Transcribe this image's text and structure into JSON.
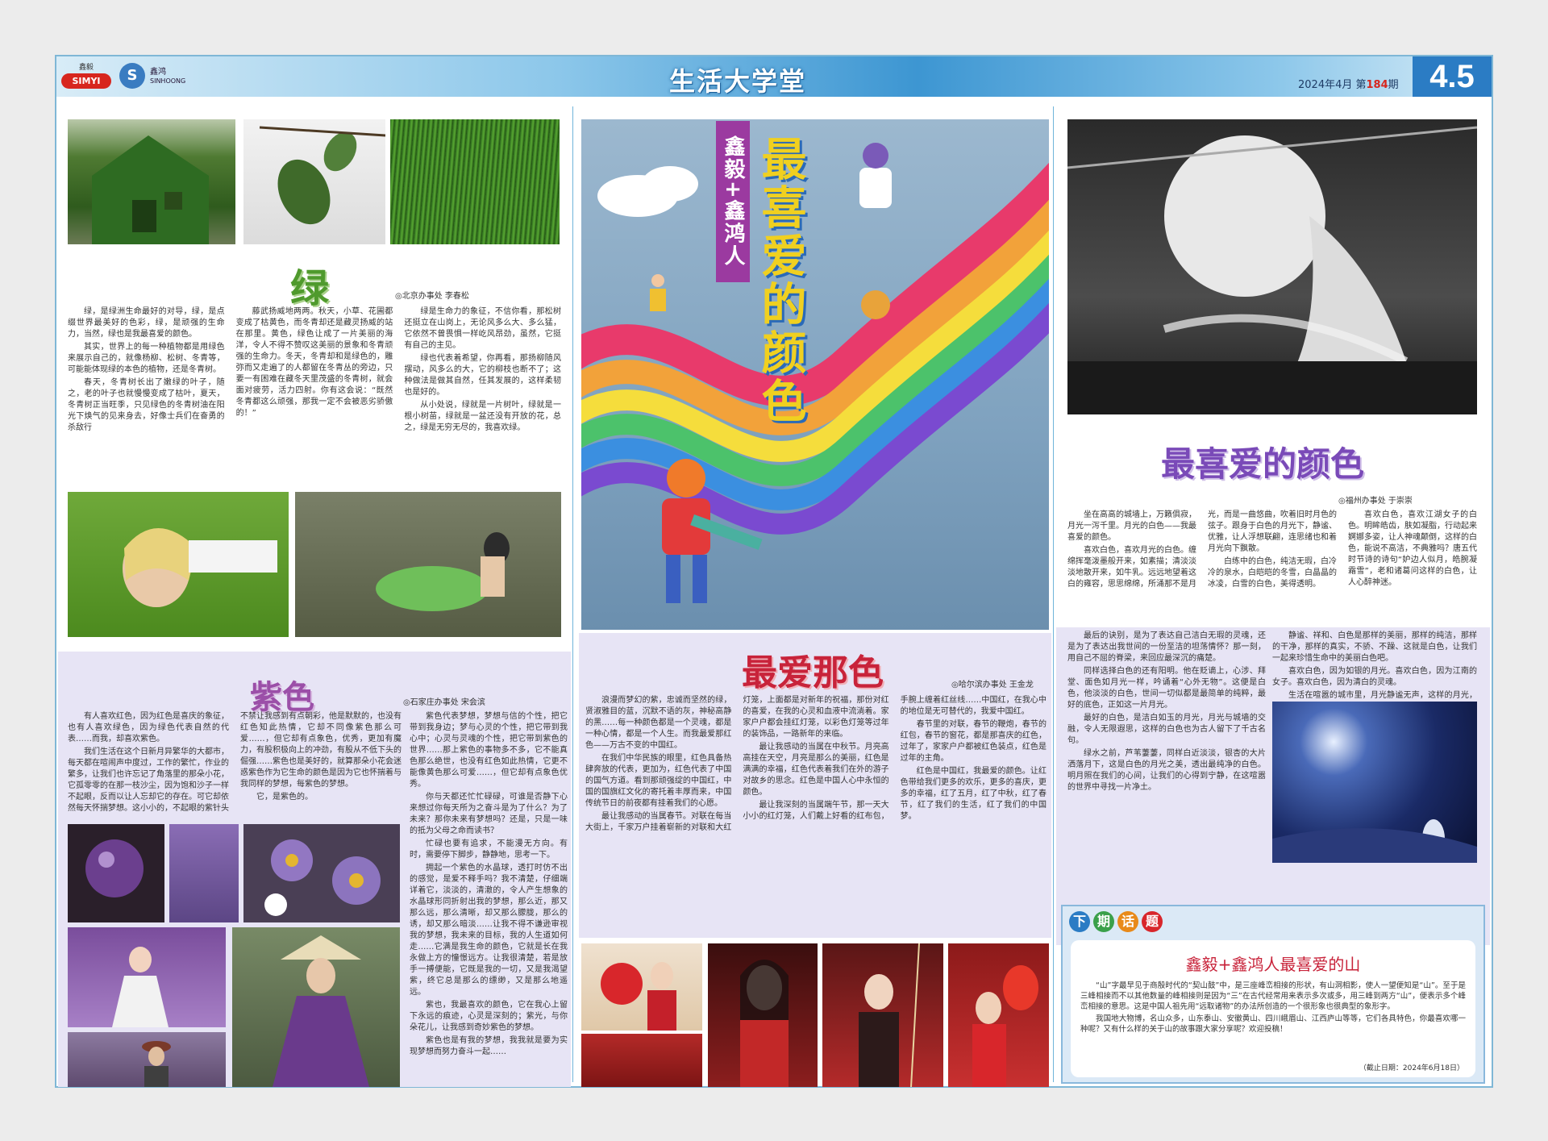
{
  "masthead": {
    "logo1_cn": "鑫毅",
    "logo1_en": "SIMYI",
    "logo2_mark": "S",
    "logo2_cn": "鑫鸿",
    "logo2_en": "SINHOONG",
    "title": "生活大学堂",
    "date": "2024年4月",
    "issue_prefix": "第",
    "issue_number": "184",
    "issue_suffix": "期",
    "page_numbers": "4.5",
    "color_bar": "#2b7cc4"
  },
  "article_green": {
    "title": "绿",
    "byline_office": "◎北京办事处",
    "byline_author": "李春松",
    "paragraphs": [
      "绿，是绿洲生命最好的对导，绿，是点缀世界最美好的色彩，绿，是顽强的生命力，当然，绿也是我最喜爱的颜色。",
      "其实，世界上的每一种植物都是用绿色来展示自己的，就像杨柳、松树、冬青等，可能能体现绿的本色的植物，还是冬青树。",
      "春天，冬青树长出了嫩绿的叶子，随之，老的叶子也就慢慢变成了枯叶，夏天，冬青树正当旺季，只见绿色的冬青树油在阳光下焕气的见来身去，好像士兵们在奋勇的杀敌行",
      "藤武扬威地两两。秋天，小草、花圃都变成了枯黄色，而冬青却还是藏灵扬威的站在那里。黄色，绿色让成了一片美丽的海洋，令人不得不赞叹这美丽的景象和冬青顽强的生命力。冬天，冬青却和是绿色的，雕弥而又走遍了的人都留在冬青丛的旁边，只要一有困难在藏冬天里茂盛的冬青树，就会面对疲劳，活力四射。你有这会说：“既然冬青都这么顽强，那我一定不会被恶劣骄傲的！”",
      "绿是生命力的象征，不信你看，那松树还挺立在山岗上，无论风多么大、多么猛，它依然不曾畏惧一样屹风昂劲，虽然，它挺有自己的主见。",
      "绿也代表着希望，你再看，那扬柳随风摆动，风多么的大，它的柳枝也断不了；这种做法是做其自然，任其发展的，这样柔韧也是好的。",
      "从小处说，绿就是一片树叶，绿就是一根小树苗，绿就是一盆还没有开放的花，总之，绿是无穷无尽的，我喜欢绿。"
    ]
  },
  "article_purple": {
    "title": "紫色",
    "byline_office": "◎石家庄办事处",
    "byline_author": "宋会滨",
    "paragraphs": [
      "有人喜欢红色，因为红色是喜庆的象征，也有人喜欢绿色，因为绿色代表自然的代表……而我，却喜欢紫色。",
      "我们生活在这个日新月异繁华的大都市，每天都在喧闹声中度过，工作的繁忙，作业的繁多，让我们也许忘记了角落里的那朵小花，它孤零零的在那一枝沙尘，因为饱和沙子一样不起眼，反而以让人忘却它的存在。可它却依然每天怀揣梦想。这小小的，不起眼的紫针头不禁让我感到有点朝彩，他是默默的，也没有红色知此热情，它却不同像紫色那么可爱……，但它却有点象色，优秀，更加有魔力，有股积极向上的冲劲，有股从不低下头的倔强……紫色也是美好的，就算那朵小花会迷惑紫色作为它生命的颜色是因为它也怀揣着与我同样的梦想，每紫色的梦想。",
      "它，是紫色的。",
      "紫色代表梦想，梦想与信的个性，把它带到我身边；梦与心灵的个性，把它带到我心中；心灵与灵魂的个性，把它带到紫色的世界……那上紫色的事物多不多，它不能真色那么绝世，也没有红色如此热情，它更不能像黄色那么可爱……，但它却有点象色优秀。",
      "你与天都还忙忙碌碌，可谁是否静下心来想过你每天所为之奋斗是为了什么？为了未来？那你未来有梦想吗？还是，只是一味的抵为父母之命而读书？",
      "忙碌也要有追求，不能漫无方向。有时，需要停下脚步，静静地，思考一下。",
      "拥起一个紫色的水晶球，透打时仿不出的感觉，是爱不释手吗？我不清楚，仔细端详着它，淡淡的，清澈的，令人产生想象的水晶球形同折射出我的梦想，那么近，那又那么远，那么清晰，却又那么朦胧，那么的诱，却又那么暗淡……让我不得不谦逊审视我的梦想，我未来的目标，我的人生道如何走……它满是我生命的颜色，它就是长在我永做上方的憧憬远方。让我很清楚，若是放手一搏便能，它既是我的一切，又是我渴望紫，终它总是那么的缥缈，又是那么地遥远。",
      "紫也，我最喜欢的颜色，它在我心上留下永远的痕迹，心灵是深刻的；紫光，与你朵花儿，让我感到奇妙紫色的梦想。",
      "紫色也是有我的梦想，我我就是要为实现梦想而努力奋斗一起……"
    ]
  },
  "feature_center": {
    "side_label": "鑫毅+鑫鸿人",
    "title": "最喜爱的颜色"
  },
  "article_red": {
    "title": "最爱那色",
    "byline_office": "◎哈尔滨办事处",
    "byline_author": "王金龙",
    "paragraphs": [
      "浪漫而梦幻的紫，忠诚而坚然的绿，贤淑雅目的蓝，沉默不语的灰，神秘高静的黑……每一种颜色都是一个灵魂，都是一种心情，都是一个人生。而我最爱那红色——万古不变的中国红。",
      "在我们中华民族的眼里，红色具备热肆奔放的代表，更加为，红色代表了中国的国气方道。看到那顽强绽的中国红，中国的国旗红文化的寄托着丰厚而来，中国传统节日的前夜都有挂着我们的心愿。",
      "最让我感动的当属春节。对联在每当大街上，千家万户挂着崭新的对联和大红灯笼，上面都是对新年的祝福，那份对红的喜爱，在我的心灵和血液中流淌着。家家户户都会挂红灯笼，以彩色灯笼等过年的装饰品，一路新年的来临。",
      "最让我感动的当属在中秋节。月亮高高挂在天空，月亮是那么的美丽，红色是满满的幸福，红色代表着我们在外的游子对故乡的思念。红色是中国人心中永恒的颜色。",
      "最让我深刻的当属端午节，那一天大小小的红灯笼，人们戴上好看的红布包，手腕上缠着红丝线……中国红，在我心中的地位是无可替代的，我爱中国红。",
      "春节里的对联，春节的鞭炮，春节的红包，春节的窗花，都是那喜庆的红色，过年了，家家户户都被红色装点，红色是过年的主角。",
      "红色是中国红，我最爱的颜色。让红色带给我们更多的欢乐，更多的喜庆，更多的幸福，红了五月，红了中秋，红了春节，红了我们的生活，红了我们的中国梦。"
    ]
  },
  "article_moon": {
    "title": "最喜爱的颜色",
    "byline_office": "◎福州办事处",
    "byline_author": "于崇崇",
    "paragraphs": [
      "坐在高高的城墙上，万籁俱寂，月光一泻千里。月光的白色——我最喜爱的颜色。",
      "喜欢白色，喜欢月光的白色。缠绵挥毫泼墨般开来，如素描；清淡淡淡地散开来，如牛乳。远远地望着这白的雍容，思思绵绵，所涌那不是月光，而是一曲悠曲，吹着旧时月色的弦子。跟身于白色的月光下，静谧、优雅，让人浮想联翩，连思绪也和着月光向下飘散。",
      "白练中的白色，纯洁无瑕，白冷冷的泉水，白皑皑的冬雪，白晶晶的冰凌，白雪的白色，美得透明。",
      "喜欢白色，喜欢江湖女子的白色。明眸皓齿，肤如凝脂，行动起来婀娜多姿，让人神魂颠倒，这样的白色，能说不高洁，不典雅吗？唐五代时节诗的诗句“妒边人似月，皓腕凝霜雪”，老和诸葛问这样的白色，让人心醉神迷。",
      "最后的诀别，是为了表达自己洁白无瑕的灵魂，还是为了表达出我世间的一份至洁的坦荡情怀？那一刻，用自己不屈的脊梁，来回应最深沉的痛楚。",
      "同样选择白色的还有阳明。他在贬谪上，心涉、拜堂、面色如月光一样，吟诵着“心外无物”。这便是白色，他淡淡的白色，世间一切似都是最简单的纯粹，最好的底色，正如这一片月光。",
      "最好的白色，是洁白如玉的月光，月光与城墙的交融，令人无限遐思，这样的白色也为古人留下了千古名句。",
      "绿水之前，芦苇萋萋，同样白近淡淡，银杏的大片洒落月下，这是白色的月光之美，透出最纯净的白色。明月照在我们的心间，让我们的心得到宁静，在这喧嚣的世界中寻找一片净土。",
      "静谧、祥和、白色是那样的美丽，那样的纯洁，那样的干净，那样的真实，不骄、不躁、这就是白色，让我们一起来珍惜生命中的美丽白色吧。",
      "喜欢白色，因为如银的月光。喜欢白色，因为江南的女子。喜欢白色，因为清白的灵魂。",
      "生活在喧嚣的城市里，月光静谧无声，这样的月光，是心底最美好的珍藏，我也愿意以月光般的白色，来装点我的人生，那就是我最爱的颜色。"
    ]
  },
  "next_topic": {
    "label_chars": [
      "下",
      "期",
      "话",
      "题"
    ],
    "title": "鑫毅+鑫鸿人最喜爱的山",
    "paragraphs": [
      "“山”字最早见于商殷时代的“契山鼓”中，是三座峰峦相接的形状，有山洞相影，使人一望便知是“山”。至于是三峰相接而不以其他数量的峰相接则是因为“三”在古代经常用来表示多次或多，用三峰到两方“山”，便表示多个峰峦相接的意思。这是中国人祖先用“远取诸物”的办法所创造的一个很形象也很典型的象形字。",
      "我国地大物博，名山众多，山东泰山、安徽黄山、四川峨眉山、江西庐山等等，它们各具特色，你最喜欢哪一种呢？又有什么样的关于山的故事跟大家分享呢？欢迎投稿！"
    ],
    "deadline": "（截止日期：2024年6月18日）"
  },
  "colors": {
    "page_border": "#7fb7d6",
    "purple_tint": "#e7e4f5",
    "green_title": "#4f9a2d",
    "purple_title": "#9b4fa8",
    "red_title": "#c8233a",
    "accent_blue": "#2b7cc4"
  }
}
